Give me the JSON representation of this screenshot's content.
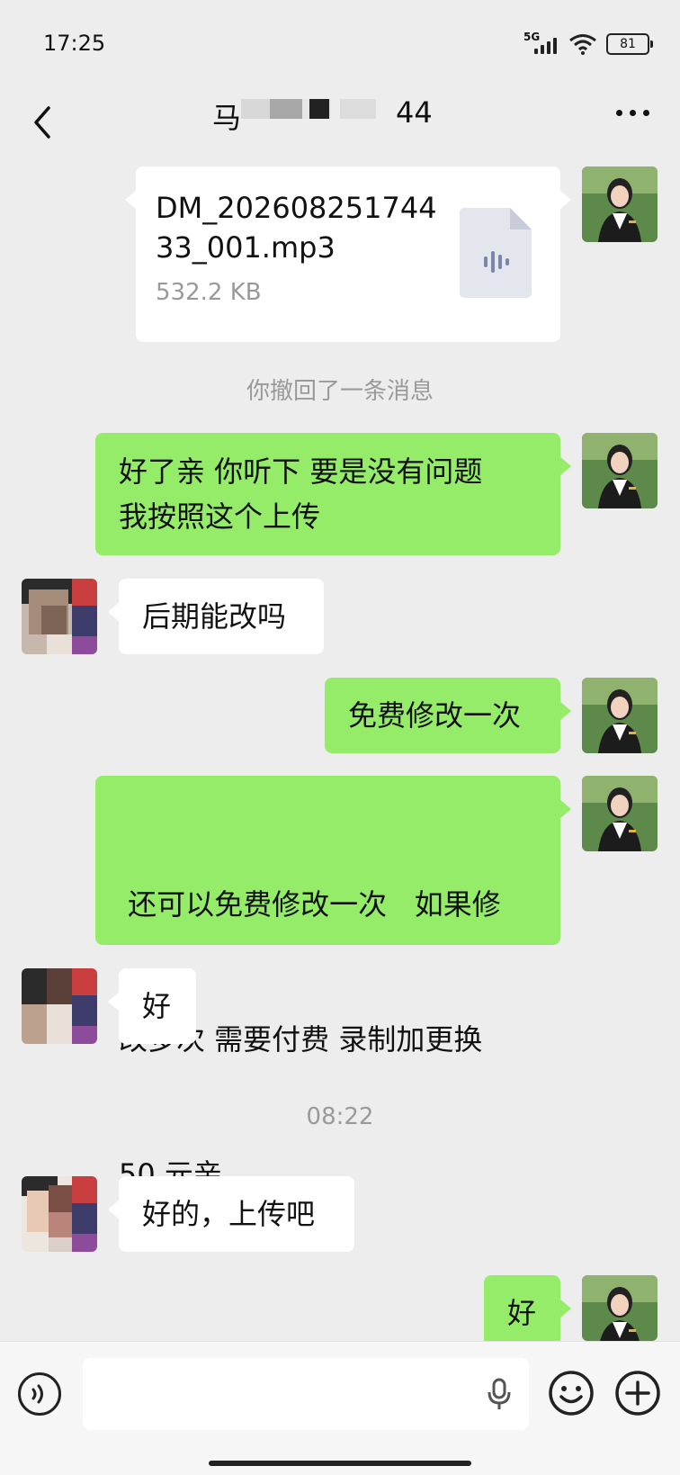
{
  "status_bar": {
    "time": "17:25",
    "network": "5G",
    "battery": "81"
  },
  "header": {
    "title_visible": "马",
    "title_suffix": "44"
  },
  "messages": [
    {
      "side": "right",
      "type": "file",
      "file_name_line1": "DM_202608251744",
      "file_name_line2": "33_001.mp3",
      "file_size": "532.2 KB"
    },
    {
      "type": "system",
      "text": "你撤回了一条消息"
    },
    {
      "side": "right",
      "type": "text",
      "line1": "好了亲  你听下 要是没有问题",
      "line2": "我按照这个上传"
    },
    {
      "side": "left",
      "type": "text",
      "text": "后期能改吗"
    },
    {
      "side": "right",
      "type": "text",
      "text": "免费修改一次"
    },
    {
      "side": "right",
      "type": "text",
      "line1": " 还可以免费修改一次   如果修",
      "line2": "改多次 需要付费 录制加更换",
      "line3": "50 元亲"
    },
    {
      "side": "left",
      "type": "text",
      "text": "好"
    },
    {
      "type": "time",
      "text": "08:22"
    },
    {
      "side": "left",
      "type": "text",
      "text": "好的，上传吧"
    },
    {
      "side": "right",
      "type": "text",
      "text": "好"
    }
  ],
  "colors": {
    "sent_bubble": "#95ec69",
    "received_bubble": "#ffffff",
    "background": "#ededed"
  },
  "icons": {
    "back": "chevron-left-icon",
    "more": "more-dots-icon",
    "voice": "voice-toggle-icon",
    "mic": "microphone-icon",
    "emoji": "emoji-icon",
    "add": "plus-icon"
  }
}
